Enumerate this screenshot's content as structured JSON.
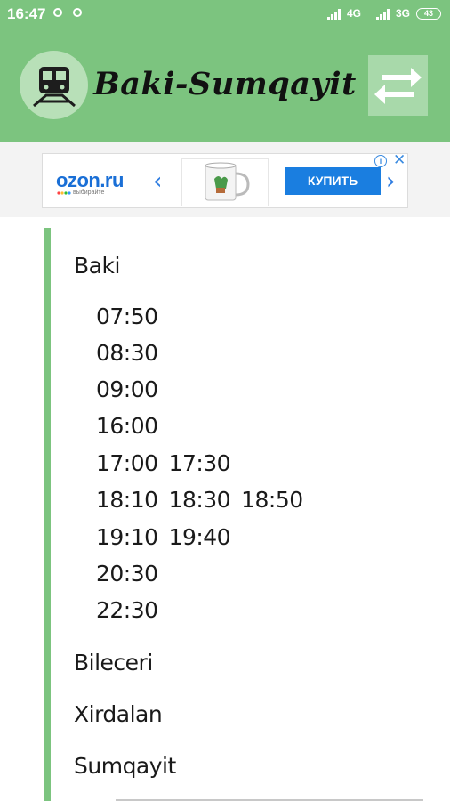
{
  "status_bar": {
    "time": "16:47",
    "network_1": "4G",
    "network_2": "3G",
    "battery": "43"
  },
  "app_bar": {
    "title": "Baki-Sumqayit",
    "color": "#7cc47f",
    "train_icon": "train-icon",
    "swap_icon": "swap-arrows-icon"
  },
  "ad": {
    "brand": "ozon.ru",
    "tagline": "выбирайте",
    "button_label": "КУПИТЬ",
    "info_label": "i",
    "close_label": "✕"
  },
  "schedule": {
    "stations": [
      {
        "name": "Baki",
        "times": [
          [
            "07:50"
          ],
          [
            "08:30"
          ],
          [
            "09:00"
          ],
          [
            "16:00"
          ],
          [
            "17:00",
            "17:30"
          ],
          [
            "18:10",
            "18:30",
            "18:50"
          ],
          [
            "19:10",
            "19:40"
          ],
          [
            "20:30"
          ],
          [
            "22:30"
          ]
        ]
      },
      {
        "name": "Bileceri"
      },
      {
        "name": "Xirdalan"
      },
      {
        "name": "Sumqayit"
      }
    ]
  }
}
